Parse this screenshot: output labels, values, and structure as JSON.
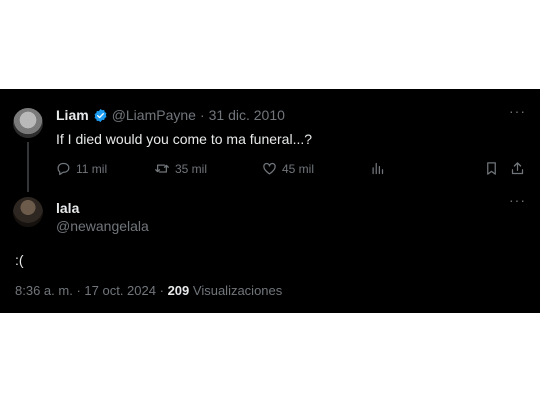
{
  "tweet": {
    "author_name": "Liam",
    "handle": "@LiamPayne",
    "separator": "·",
    "date": "31 dic. 2010",
    "text": "If I died would you come to ma funeral...?",
    "more": "···",
    "replies": "11 mil",
    "retweets": "35 mil",
    "likes": "45 mil"
  },
  "reply": {
    "author_name": "lala",
    "handle": "@newangelala",
    "more": "···",
    "text": ":(",
    "time": "8:36 a. m.",
    "dot": "·",
    "date": "17 oct. 2024",
    "views_count": "209",
    "views_label": "Visualizaciones"
  },
  "colors": {
    "background": "#000000",
    "text": "#e7e9ea",
    "muted": "#71767b",
    "verified": "#1d9bf0"
  },
  "icons": [
    "verified-badge-icon",
    "reply-icon",
    "retweet-icon",
    "like-icon",
    "views-icon",
    "bookmark-icon",
    "share-icon",
    "more-icon"
  ]
}
